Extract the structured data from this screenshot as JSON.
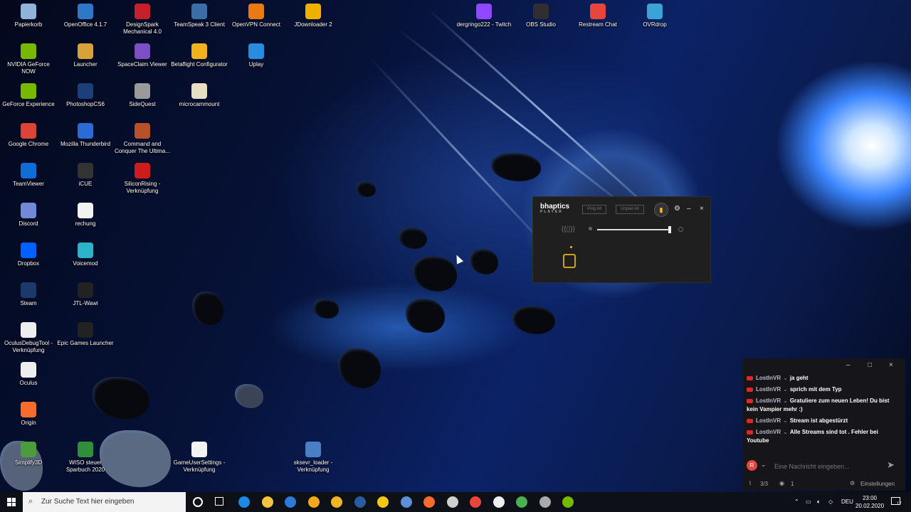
{
  "desktop_icons": [
    {
      "label": "Papierkorb",
      "icon": "recycle-bin-icon",
      "color": "#8fb3d9"
    },
    {
      "label": "OpenOffice 4.1.7",
      "icon": "openoffice-icon",
      "color": "#2f78c8"
    },
    {
      "label": "DesignSpark Mechanical 4.0",
      "icon": "designspark-icon",
      "color": "#c81f2c"
    },
    {
      "label": "TeamSpeak 3 Client",
      "icon": "teamspeak-icon",
      "color": "#3a6ea8"
    },
    {
      "label": "OpenVPN Connect",
      "icon": "openvpn-icon",
      "color": "#ea7a14"
    },
    {
      "label": "JDownloader 2",
      "icon": "jdownloader-icon",
      "color": "#f0b000"
    },
    {
      "label": "dergringo222 - Twitch",
      "icon": "twitch-icon",
      "color": "#9146ff"
    },
    {
      "label": "OBS Studio",
      "icon": "obs-icon",
      "color": "#302e31"
    },
    {
      "label": "Restream Chat",
      "icon": "restream-icon",
      "color": "#e8463c"
    },
    {
      "label": "OVRdrop",
      "icon": "ovrdrop-icon",
      "color": "#3ba3d6"
    },
    {
      "label": "NVIDIA GeForce NOW",
      "icon": "nvidia-icon",
      "color": "#76b900"
    },
    {
      "label": "Launcher",
      "icon": "launcher-icon",
      "color": "#d8a13a"
    },
    {
      "label": "SpaceClaim Viewer",
      "icon": "spaceclaim-icon",
      "color": "#7d4fc6"
    },
    {
      "label": "Betaflight Configurator",
      "icon": "betaflight-icon",
      "color": "#f2b21d"
    },
    {
      "label": "Uplay",
      "icon": "uplay-icon",
      "color": "#2a8ce0"
    },
    {
      "label": "GeForce Experience",
      "icon": "geforce-icon",
      "color": "#76b900"
    },
    {
      "label": "PhotoshopCS6",
      "icon": "photoshop-icon",
      "color": "#1c3f7a"
    },
    {
      "label": "SideQuest",
      "icon": "sidequest-icon",
      "color": "#9a9a9a"
    },
    {
      "label": "microcammount",
      "icon": "file-icon",
      "color": "#e6dfc2"
    },
    {
      "label": "Google Chrome",
      "icon": "chrome-icon",
      "color": "#db4437"
    },
    {
      "label": "Mozilla Thunderbird",
      "icon": "thunderbird-icon",
      "color": "#2a6bd6"
    },
    {
      "label": "Command and Conquer The Ultima...",
      "icon": "cnc-icon",
      "color": "#b8502a"
    },
    {
      "label": "TeamViewer",
      "icon": "teamviewer-icon",
      "color": "#0e6ed6"
    },
    {
      "label": "iCUE",
      "icon": "icue-icon",
      "color": "#333333"
    },
    {
      "label": "SiliconRising - Verknüpfung",
      "icon": "siliconrising-icon",
      "color": "#cc1c1c"
    },
    {
      "label": "Discord",
      "icon": "discord-icon",
      "color": "#7289da"
    },
    {
      "label": "rechung",
      "icon": "document-icon",
      "color": "#f2f2f2"
    },
    {
      "label": "Dropbox",
      "icon": "dropbox-icon",
      "color": "#0061ff"
    },
    {
      "label": "Voicemod",
      "icon": "voicemod-icon",
      "color": "#2ab3c9"
    },
    {
      "label": "Steam",
      "icon": "steam-icon",
      "color": "#1b3a6b"
    },
    {
      "label": "JTL-Wawi",
      "icon": "jtl-icon",
      "color": "#222222"
    },
    {
      "label": "OculusDebugTool - Verknüpfung",
      "icon": "oculus-icon",
      "color": "#eeeeee"
    },
    {
      "label": "Epic Games Launcher",
      "icon": "epic-icon",
      "color": "#222222"
    },
    {
      "label": "Oculus",
      "icon": "oculus-icon",
      "color": "#eeeeee"
    },
    {
      "label": "Origin",
      "icon": "origin-icon",
      "color": "#f56c2d"
    },
    {
      "label": "Simplify3D",
      "icon": "simplify3d-icon",
      "color": "#4c9b3c"
    },
    {
      "label": "WISO steuer Sparbuch 2020",
      "icon": "wiso-icon",
      "color": "#2f8f3a"
    },
    {
      "label": "GameUserSettings - Verknüpfung",
      "icon": "file-icon",
      "color": "#f2f2f2"
    },
    {
      "label": "sksevr_loader - Verknüpfung",
      "icon": "exe-icon",
      "color": "#4a7fc4"
    }
  ],
  "bhaptics": {
    "brand": "bhaptics",
    "brand_sub": "PLAYER",
    "ping_all": "Ping All",
    "unpair_all": "Unpair All",
    "intensity_level": 0.98
  },
  "chat": {
    "messages": [
      {
        "user": "LostInVR",
        "text": "ja geht"
      },
      {
        "user": "LostInVR",
        "text": "sprich mit dem Typ"
      },
      {
        "user": "LostInVR",
        "text": "Gratuliere zum neuen Leben! Du bist kein Vampier mehr :)"
      },
      {
        "user": "LostInVR",
        "text": "Stream ist abgestürzt"
      },
      {
        "user": "LostInVR",
        "text": "Alle Streams sind tot . Fehler bei Youtube"
      }
    ],
    "input_placeholder": "Eine Nachricht eingeben...",
    "stream_count": "3/3",
    "viewer_count": "1",
    "settings_label": "Einstellungen"
  },
  "taskbar": {
    "search_placeholder": "Zur Suche Text hier eingeben",
    "language": "DEU",
    "time": "23:00",
    "date": "20.02.2020",
    "notification_count": "17",
    "apps": [
      {
        "icon": "edge-icon",
        "color": "#1e88e5"
      },
      {
        "icon": "file-explorer-icon",
        "color": "#f4c542"
      },
      {
        "icon": "store-icon",
        "color": "#2d7bd6"
      },
      {
        "icon": "folder-icon",
        "color": "#f2a81d"
      },
      {
        "icon": "chrome-icon",
        "color": "#f0b429"
      },
      {
        "icon": "steam-icon",
        "color": "#2a5aa0"
      },
      {
        "icon": "bhaptics-icon",
        "color": "#f5c518"
      },
      {
        "icon": "teamspeak-icon",
        "color": "#5c8fd6"
      },
      {
        "icon": "origin-icon",
        "color": "#f56c2d"
      },
      {
        "icon": "obs-icon",
        "color": "#cfcfcf"
      },
      {
        "icon": "restream-icon",
        "color": "#e8463c"
      },
      {
        "icon": "oculus-icon",
        "color": "#eeeeee"
      },
      {
        "icon": "chrome-icon",
        "color": "#4caf50"
      },
      {
        "icon": "sidequest-icon",
        "color": "#aaaaaa"
      },
      {
        "icon": "geforce-icon",
        "color": "#76b900"
      }
    ]
  }
}
